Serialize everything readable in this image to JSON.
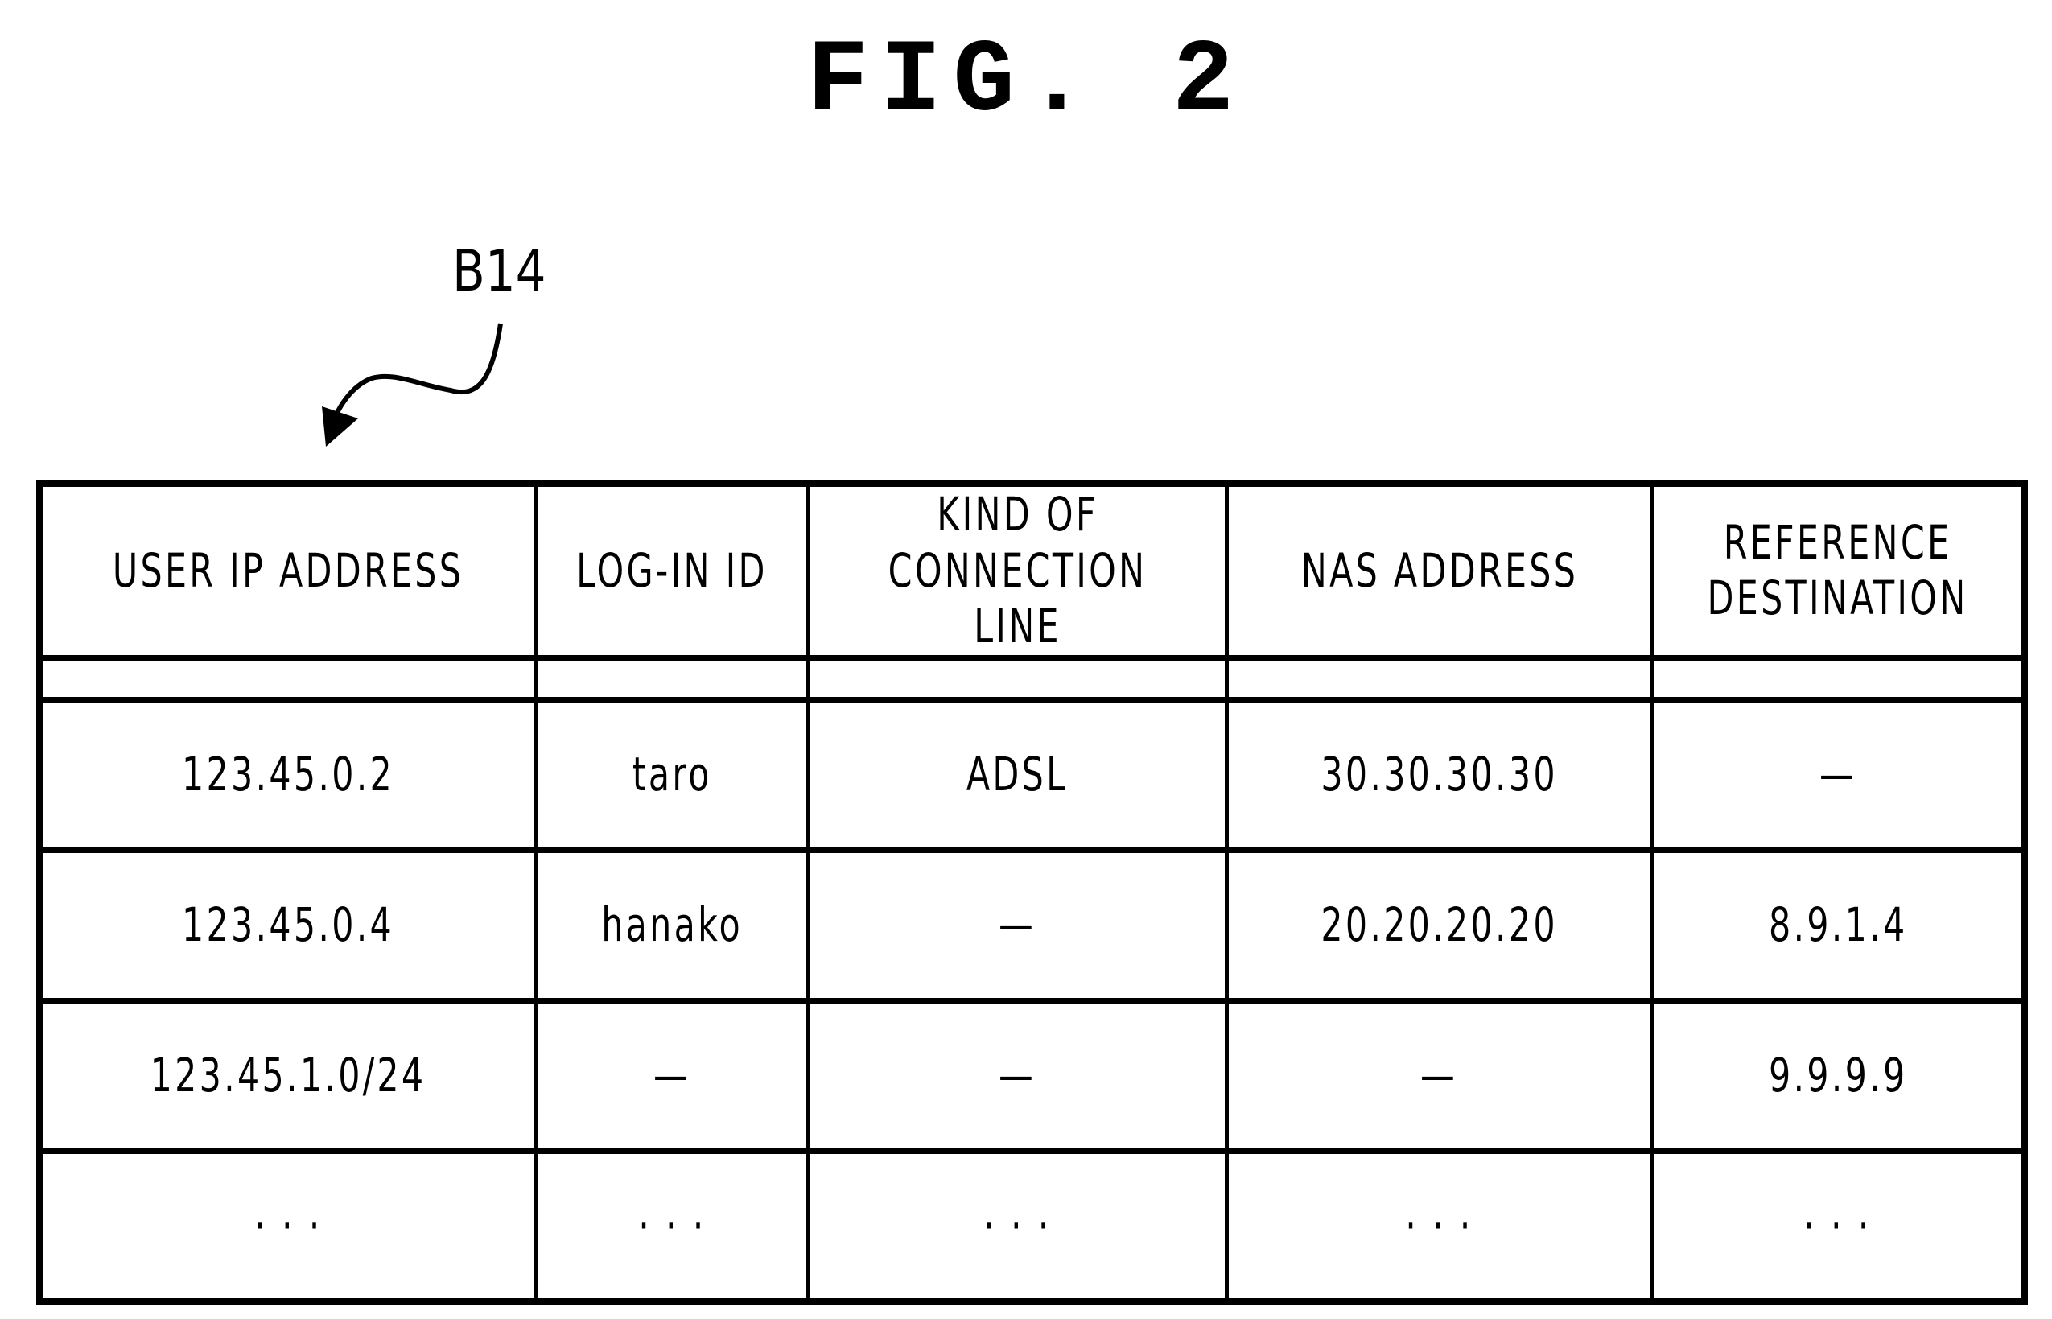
{
  "figure": {
    "title": "FIG. 2",
    "reference_label": "B14"
  },
  "table": {
    "columns": [
      "USER IP ADDRESS",
      "LOG-IN ID",
      "KIND OF\nCONNECTION LINE",
      "NAS ADDRESS",
      "REFERENCE\nDESTINATION"
    ],
    "rows": [
      [
        "123.45.0.2",
        "taro",
        "ADSL",
        "30.30.30.30",
        "—"
      ],
      [
        "123.45.0.4",
        "hanako",
        "—",
        "20.20.20.20",
        "8.9.1.4"
      ],
      [
        "123.45.1.0/24",
        "—",
        "—",
        "—",
        "9.9.9.9"
      ],
      [
        "· · ·",
        "· · ·",
        "· · ·",
        "· · ·",
        "· · ·"
      ]
    ]
  }
}
